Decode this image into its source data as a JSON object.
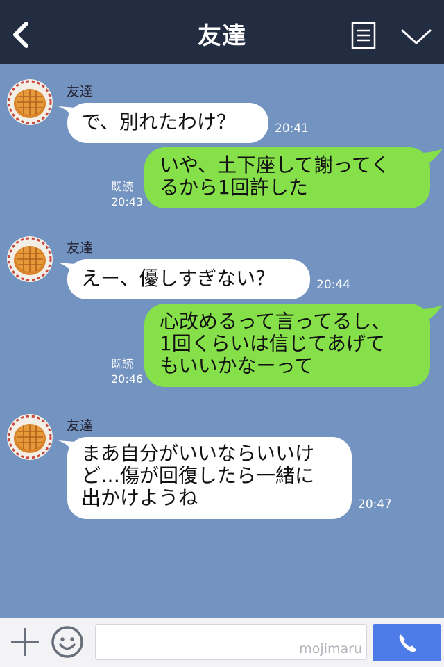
{
  "header": {
    "title": "友達"
  },
  "messages": [
    {
      "side": "left",
      "sender": "友達",
      "lines": [
        "で、別れたわけ？"
      ],
      "time": "20:41"
    },
    {
      "side": "right",
      "read": "既読",
      "lines": [
        "いや、土下座して謝ってく",
        "るから1回許した"
      ],
      "time": "20:43"
    },
    {
      "side": "left",
      "sender": "友達",
      "lines": [
        "えー、優しすぎない？"
      ],
      "time": "20:44"
    },
    {
      "side": "right",
      "read": "既読",
      "lines": [
        "心改めるって言ってるし、",
        "1回くらいは信じてあげて",
        "もいいかなーって"
      ],
      "time": "20:46"
    },
    {
      "side": "left",
      "sender": "友達",
      "lines": [
        "まあ自分がいいならいいけ",
        "ど…傷が回復したら一緒に",
        "出かけようね"
      ],
      "time": "20:47"
    }
  ],
  "input": {
    "watermark": "mojimaru"
  },
  "colors": {
    "header_bg": "#232d42",
    "chat_bg": "#7393c0",
    "bubble_left": "#ffffff",
    "bubble_right": "#86e04a",
    "call_button": "#4d7ce8"
  },
  "icons": [
    "back-icon",
    "menu-icon",
    "chevron-down-icon",
    "plus-icon",
    "smile-icon",
    "phone-icon"
  ]
}
